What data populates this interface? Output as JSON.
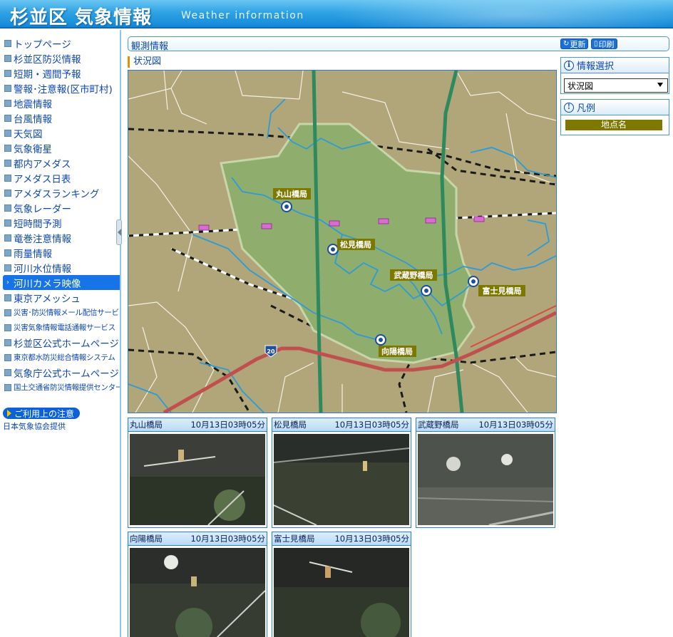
{
  "header": {
    "title": "杉並区 気象情報",
    "subtitle": "Weather information"
  },
  "sidebar": {
    "items": [
      {
        "label": "トップページ",
        "small": false,
        "active": false
      },
      {
        "label": "杉並区防災情報",
        "small": false,
        "active": false
      },
      {
        "label": "短期・週間予報",
        "small": false,
        "active": false
      },
      {
        "label": "警報･注意報(区市町村)",
        "small": false,
        "active": false
      },
      {
        "label": "地震情報",
        "small": false,
        "active": false
      },
      {
        "label": "台風情報",
        "small": false,
        "active": false
      },
      {
        "label": "天気図",
        "small": false,
        "active": false
      },
      {
        "label": "気象衛星",
        "small": false,
        "active": false
      },
      {
        "label": "都内アメダス",
        "small": false,
        "active": false
      },
      {
        "label": "アメダス日表",
        "small": false,
        "active": false
      },
      {
        "label": "アメダスランキング",
        "small": false,
        "active": false
      },
      {
        "label": "気象レーダー",
        "small": false,
        "active": false
      },
      {
        "label": "短時間予測",
        "small": false,
        "active": false
      },
      {
        "label": "竜巻注意情報",
        "small": false,
        "active": false
      },
      {
        "label": "雨量情報",
        "small": false,
        "active": false
      },
      {
        "label": "河川水位情報",
        "small": false,
        "active": false
      },
      {
        "label": "河川カメラ映像",
        "small": false,
        "active": true
      },
      {
        "label": "東京アメッシュ",
        "small": false,
        "active": false
      },
      {
        "label": "災害･防災情報メール配信サービス",
        "small": true,
        "active": false
      },
      {
        "label": "災害気象情報電話通報サービス",
        "small": true,
        "active": false
      },
      {
        "label": "杉並区公式ホームページ",
        "small": false,
        "active": false
      },
      {
        "label": "東京都水防災総合情報システム",
        "small": true,
        "active": false
      },
      {
        "label": "気象庁公式ホームページ",
        "small": false,
        "active": false
      },
      {
        "label": "国土交通省防災情報提供センター",
        "small": true,
        "active": false
      }
    ],
    "notice_label": "ご利用上の注意",
    "provider": "日本気象協会提供"
  },
  "panel": {
    "title": "観測情報",
    "refresh_label": "更新",
    "print_label": "印刷"
  },
  "map": {
    "heading": "状況図",
    "road_number": "20",
    "stations": [
      {
        "name": "丸山橋局"
      },
      {
        "name": "松見橋局"
      },
      {
        "name": "武蔵野橋局"
      },
      {
        "name": "富士見橋局"
      },
      {
        "name": "向陽橋局"
      }
    ]
  },
  "info_select": {
    "heading": "情報選択",
    "selected": "状況図"
  },
  "legend": {
    "heading": "凡例",
    "item": "地点名"
  },
  "cameras": [
    {
      "name": "丸山橋局",
      "time": "10月13日03時05分"
    },
    {
      "name": "松見橋局",
      "time": "10月13日03時05分"
    },
    {
      "name": "武蔵野橋局",
      "time": "10月13日03時05分"
    },
    {
      "name": "向陽橋局",
      "time": "10月13日03時05分"
    },
    {
      "name": "富士見橋局",
      "time": "10月13日03時05分"
    }
  ],
  "colors": {
    "map_background": "#b0a67a",
    "area_fill": "#8fae6e",
    "river": "#2d9bd6",
    "highway": "#c0504d",
    "major_road": "#2e8a5e",
    "station_label_bg": "#7d7800",
    "active_nav": "#1673e8"
  }
}
